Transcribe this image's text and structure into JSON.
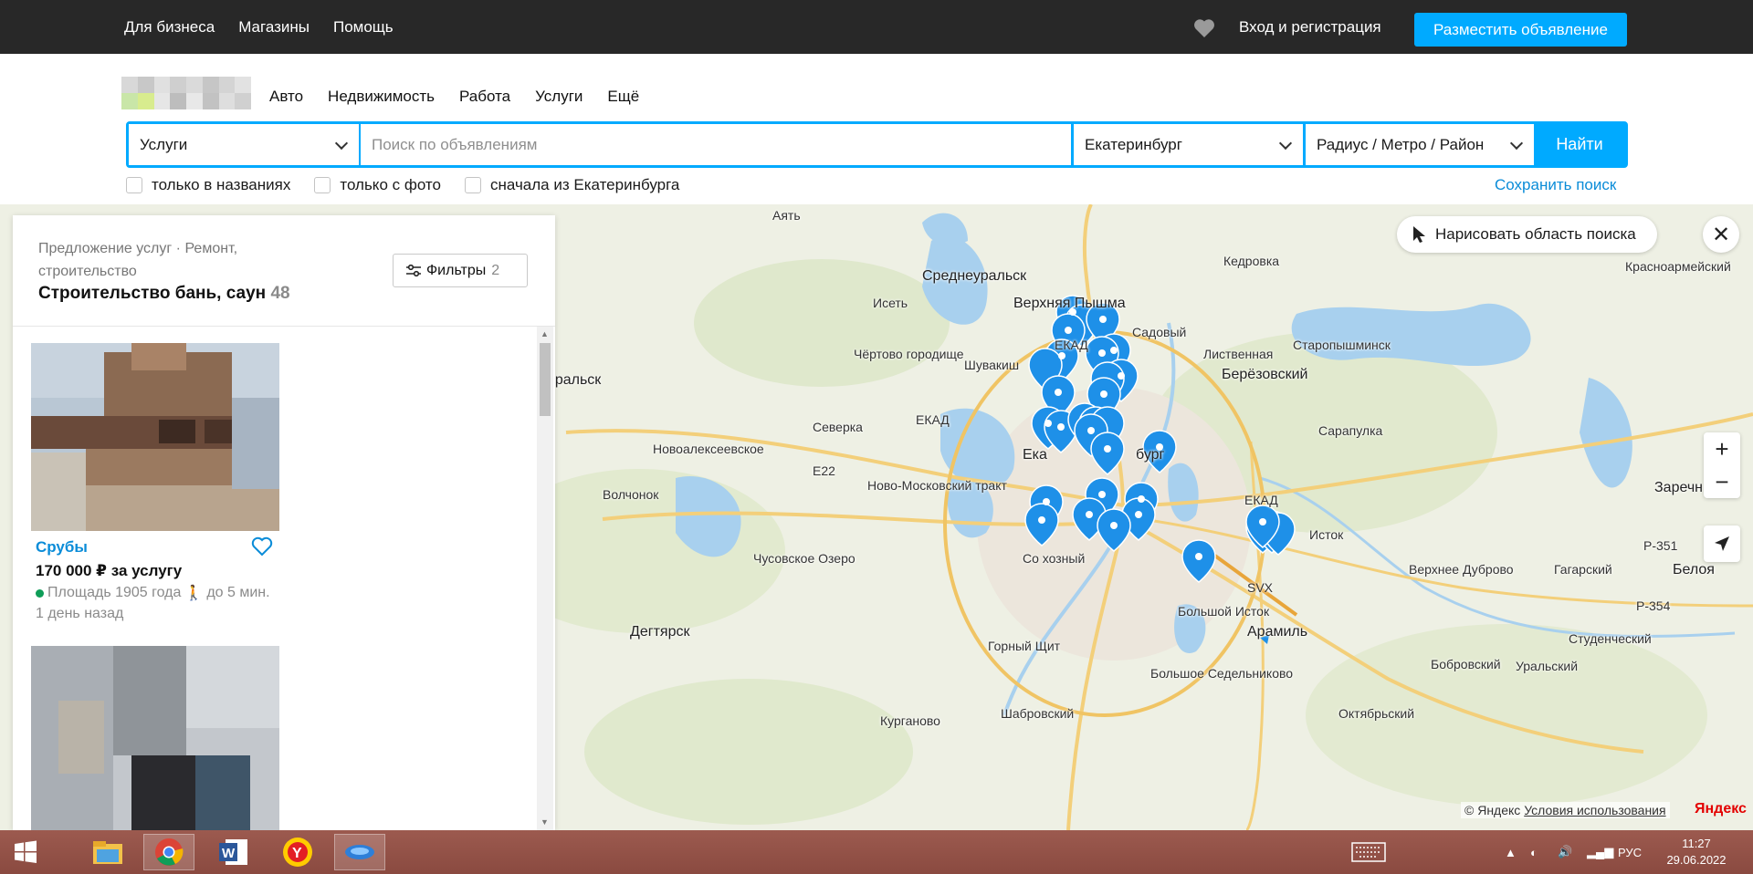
{
  "topbar": {
    "nav": [
      "Для бизнеса",
      "Магазины",
      "Помощь"
    ],
    "login": "Вход и регистрация",
    "post_button": "Разместить объявление"
  },
  "header": {
    "categories": [
      "Авто",
      "Недвижимость",
      "Работа",
      "Услуги",
      "Ещё"
    ]
  },
  "search": {
    "category": "Услуги",
    "query_placeholder": "Поиск по объявлениям",
    "city": "Екатеринбург",
    "radius": "Радиус / Метро / Район",
    "find_button": "Найти",
    "checkboxes": [
      "только в названиях",
      "только с фото",
      "сначала из Екатеринбурга"
    ],
    "save_search": "Сохранить поиск"
  },
  "panel": {
    "breadcrumb": "Предложение услуг · Ремонт, строительство",
    "title": "Строительство бань, саун",
    "count": "48",
    "filters_label": "Фильтры",
    "filters_count": "2",
    "listings": [
      {
        "name": "Срубы",
        "price": "170 000 ₽ за услугу",
        "location": "Площадь 1905 года",
        "walk": "до 5 мин.",
        "date": "1 день назад"
      }
    ]
  },
  "map": {
    "draw_area": "Нарисовать область поиска",
    "copyright": "© Яндекс",
    "terms": "Условия использования",
    "brand": "Яндекс",
    "labels": [
      {
        "text": "Аять",
        "cls": ""
      },
      {
        "text": "Среднеуральск",
        "cls": "big"
      },
      {
        "text": "Верхняя Пышма",
        "cls": "big"
      },
      {
        "text": "Кедровка",
        "cls": ""
      },
      {
        "text": "Красноармейский",
        "cls": ""
      },
      {
        "text": "Исеть",
        "cls": ""
      },
      {
        "text": "Садовый",
        "cls": ""
      },
      {
        "text": "ЕКАД",
        "cls": ""
      },
      {
        "text": "Старопышминск",
        "cls": ""
      },
      {
        "text": "Чёртово городище",
        "cls": ""
      },
      {
        "text": "Шувакиш",
        "cls": ""
      },
      {
        "text": "Лиственная",
        "cls": ""
      },
      {
        "text": "Берёзовский",
        "cls": "big"
      },
      {
        "text": "уральск",
        "cls": "big"
      },
      {
        "text": "ЕКАД",
        "cls": ""
      },
      {
        "text": "Северка",
        "cls": ""
      },
      {
        "text": "Сарапулка",
        "cls": ""
      },
      {
        "text": "Новоалексеевское",
        "cls": ""
      },
      {
        "text": "Ека",
        "cls": "big"
      },
      {
        "text": "бург",
        "cls": "big"
      },
      {
        "text": "E22",
        "cls": ""
      },
      {
        "text": "Ново-Московский тракт",
        "cls": ""
      },
      {
        "text": "Волчонок",
        "cls": ""
      },
      {
        "text": "ЕКАД",
        "cls": ""
      },
      {
        "text": "Заречн",
        "cls": "big"
      },
      {
        "text": "Исток",
        "cls": ""
      },
      {
        "text": "Р-351",
        "cls": ""
      },
      {
        "text": "Чусовское Озеро",
        "cls": ""
      },
      {
        "text": "Со  хозный",
        "cls": ""
      },
      {
        "text": "Верхнее Дуброво",
        "cls": ""
      },
      {
        "text": "Гагарский",
        "cls": ""
      },
      {
        "text": "Белоя",
        "cls": "big"
      },
      {
        "text": "SVX",
        "cls": ""
      },
      {
        "text": "Р-354",
        "cls": ""
      },
      {
        "text": "Большой Исток",
        "cls": ""
      },
      {
        "text": "Дегтярск",
        "cls": "big"
      },
      {
        "text": "Арамиль",
        "cls": "big"
      },
      {
        "text": "Студенческий",
        "cls": ""
      },
      {
        "text": "Горный Щит",
        "cls": ""
      },
      {
        "text": "Бобровский",
        "cls": ""
      },
      {
        "text": "Уральский",
        "cls": ""
      },
      {
        "text": "Большое Седельниково",
        "cls": ""
      },
      {
        "text": "Курганово",
        "cls": ""
      },
      {
        "text": "Шабровский",
        "cls": ""
      },
      {
        "text": "Октябрьский",
        "cls": ""
      }
    ]
  },
  "taskbar": {
    "lang": "РУС",
    "time": "11:27",
    "date": "29.06.2022"
  },
  "colors": {
    "accent": "#00aaff",
    "link": "#0a8cd8",
    "topbar": "#282828",
    "pin": "#1e90e8"
  }
}
